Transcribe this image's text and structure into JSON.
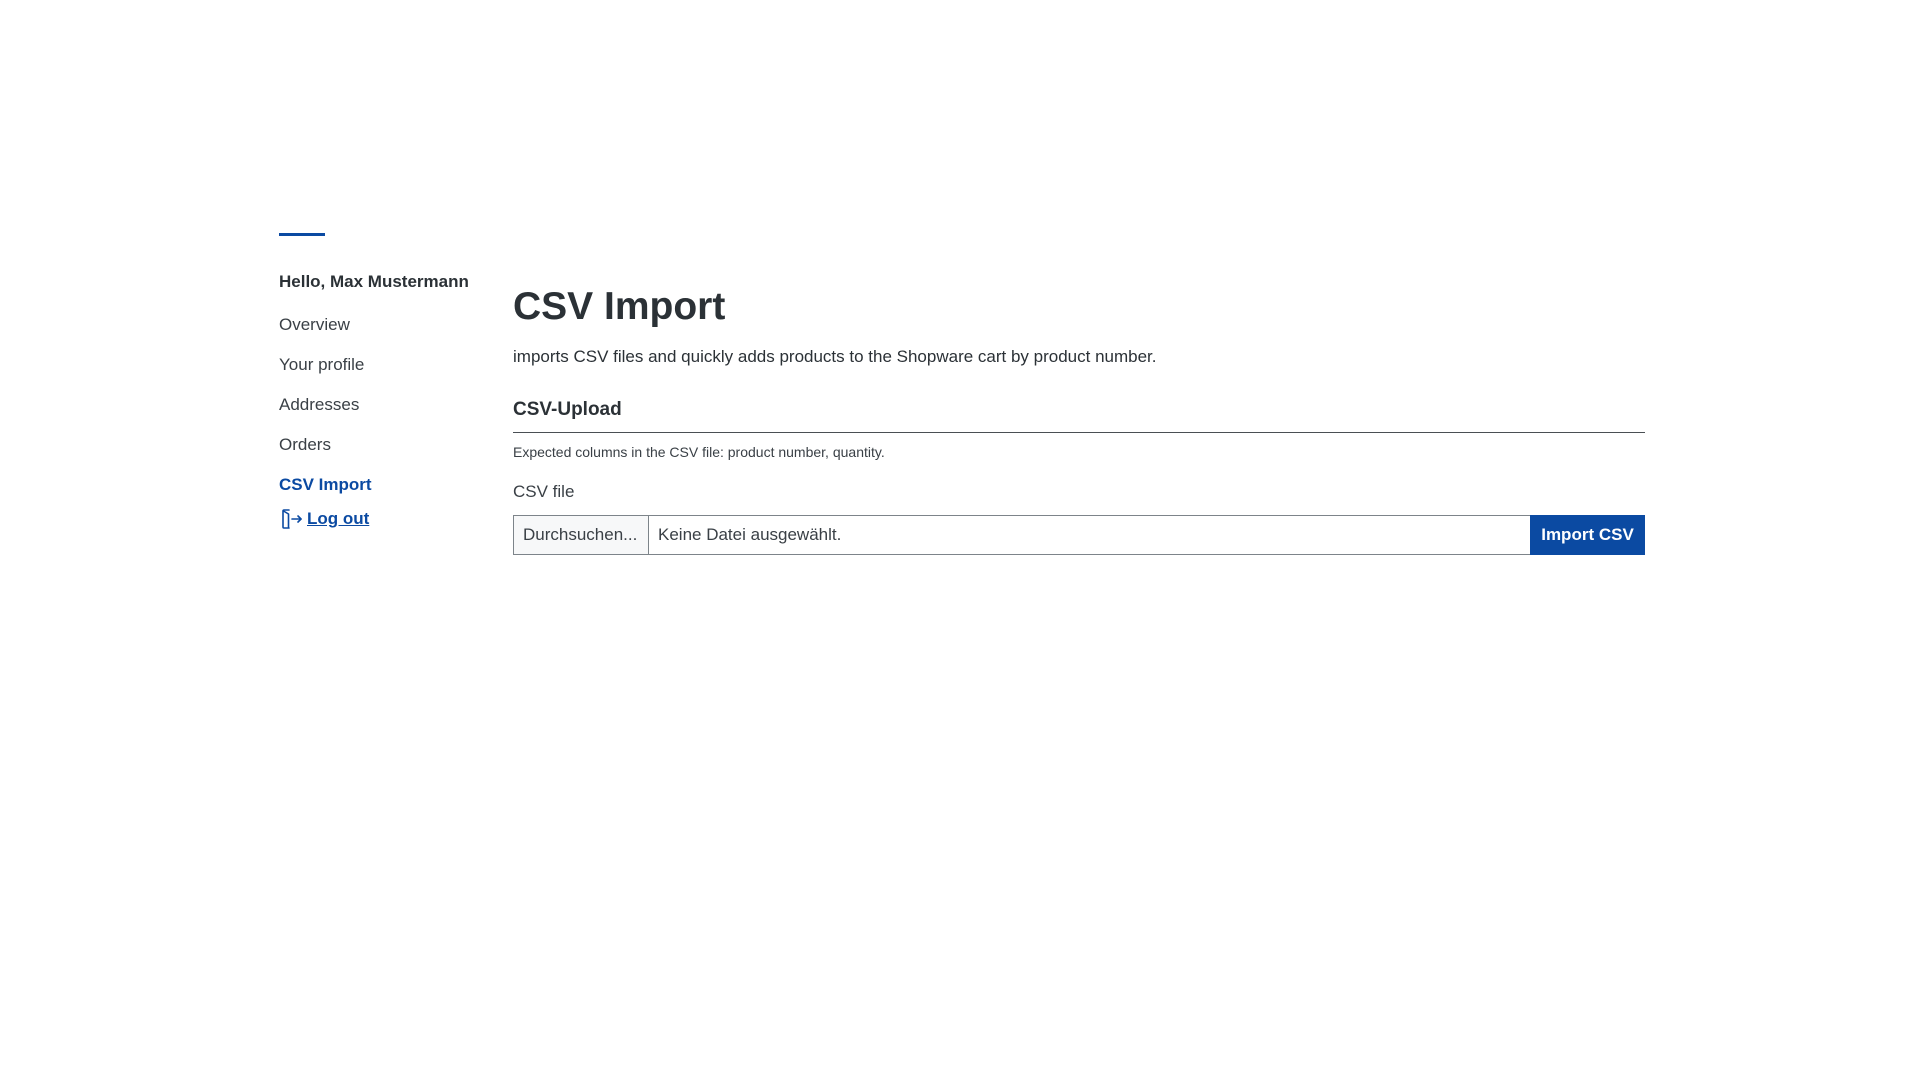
{
  "colors": {
    "accent": "#0b4aa2",
    "text": "#2b3136",
    "border": "#7d848a"
  },
  "sidebar": {
    "greeting": "Hello, Max Mustermann",
    "items": [
      {
        "label": "Overview"
      },
      {
        "label": "Your profile"
      },
      {
        "label": "Addresses"
      },
      {
        "label": "Orders"
      },
      {
        "label": "CSV Import",
        "active": true
      }
    ],
    "logout": {
      "label": "Log out",
      "icon": "logout-icon"
    }
  },
  "main": {
    "title": "CSV Import",
    "description": "imports CSV files and quickly adds products to the Shopware cart by product number.",
    "section_title": "CSV-Upload",
    "hint": "Expected columns in the CSV file: product number, quantity.",
    "field_label": "CSV file",
    "browse_label": "Durchsuchen...",
    "file_status": "Keine Datei ausgewählt.",
    "import_label": "Import CSV"
  }
}
